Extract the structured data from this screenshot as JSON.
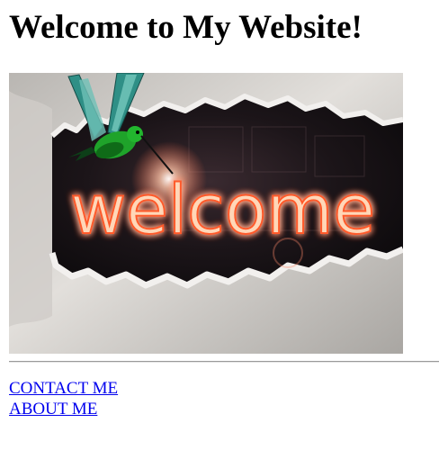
{
  "page": {
    "heading": "Welcome to My Website!"
  },
  "hero_image": {
    "word": "welcome",
    "description_icon": "hummingbird-icon",
    "colors": {
      "paper": "#d8d5d1",
      "hole": "#1a1418",
      "glow": "#ff7a4a",
      "neon_core": "#ffd7b8",
      "bird_green": "#1fa32a",
      "bird_teal": "#2f8f86"
    }
  },
  "nav": {
    "links": [
      {
        "label": "CONTACT ME"
      },
      {
        "label": "ABOUT ME"
      }
    ]
  },
  "colors": {
    "link": "#0000ee",
    "text": "#000000",
    "background": "#ffffff"
  }
}
